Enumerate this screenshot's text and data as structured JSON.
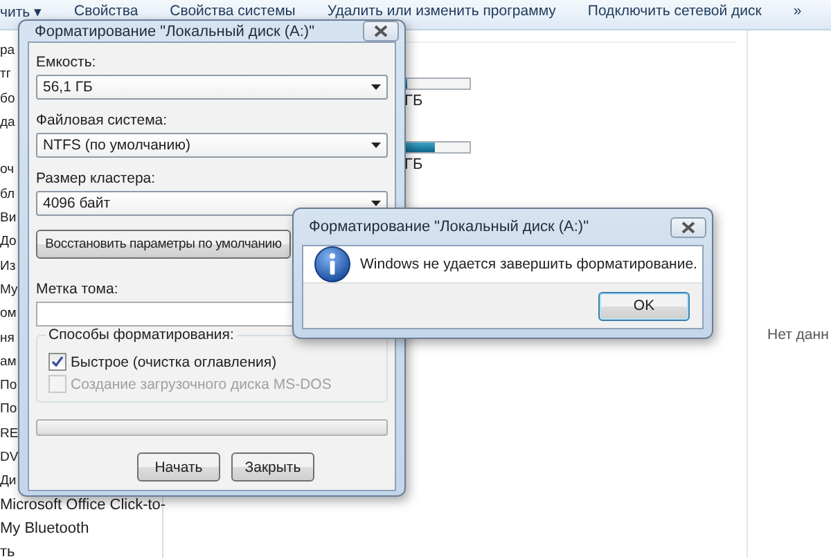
{
  "toolbar": {
    "items": [
      "чить ▾",
      "Свойства",
      "Свойства системы",
      "Удалить или изменить программу",
      "Подключить сетевой диск"
    ],
    "overflow": "»"
  },
  "sidebar": {
    "items": [
      "ра",
      "тг",
      "бо",
      "да",
      "оч",
      "бл",
      "Ви",
      "До",
      "Из",
      "Му",
      "ом",
      "ня",
      "ам",
      "По",
      "По",
      "RE",
      "DV",
      "Ди",
      "Microsoft Office Click-to-",
      "My Bluetooth",
      "ть"
    ]
  },
  "drives": [
    {
      "level": 0.03,
      "size": "ГБ"
    },
    {
      "level": 0.45,
      "size": "ГБ"
    }
  ],
  "details": {
    "text": "Нет данн"
  },
  "format_dialog": {
    "title": "Форматирование \"Локальный диск (A:)\"",
    "fields": [
      {
        "label": "Емкость:",
        "value": "56,1 ГБ"
      },
      {
        "label": "Файловая система:",
        "value": "NTFS (по умолчанию)"
      },
      {
        "label": "Размер кластера:",
        "value": "4096 байт"
      }
    ],
    "restore_button": "Восстановить параметры по умолчанию",
    "volume_label": {
      "label": "Метка тома:"
    },
    "options": {
      "title": "Способы форматирования:",
      "items": [
        {
          "label": "Быстрое (очистка оглавления)",
          "checked": true,
          "disabled": false
        },
        {
          "label": "Создание загрузочного диска MS-DOS",
          "checked": false,
          "disabled": true
        }
      ]
    },
    "progress": {
      "level": 0
    },
    "buttons": [
      "Начать",
      "Закрыть"
    ]
  },
  "message_dialog": {
    "title": "Форматирование \"Локальный диск (A:)\"",
    "message": "Windows не удается завершить форматирование.",
    "button": "OK"
  }
}
